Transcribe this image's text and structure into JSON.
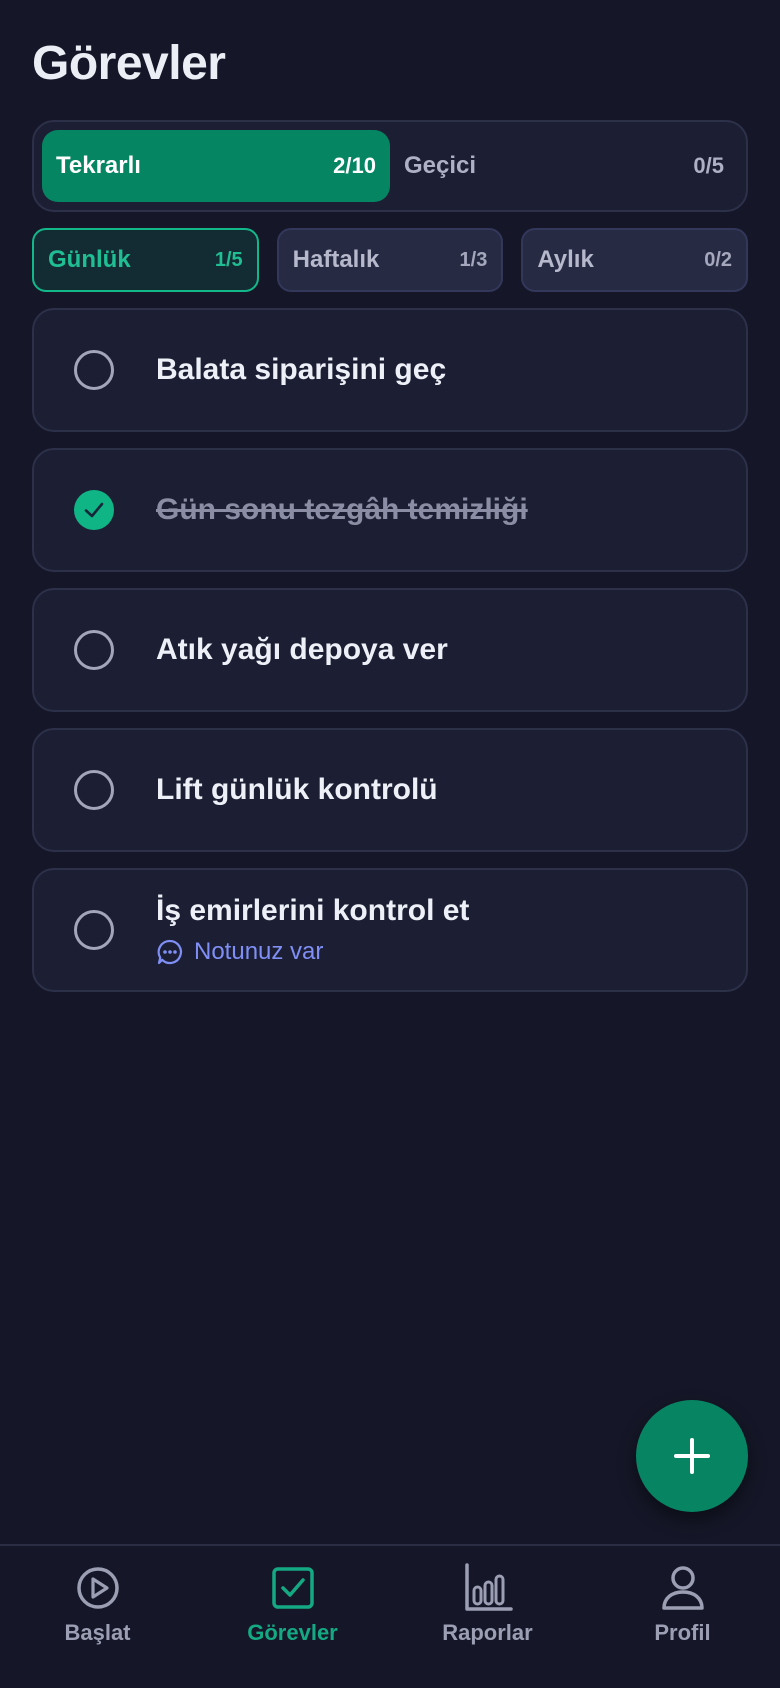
{
  "header": {
    "title": "Görevler"
  },
  "segments": [
    {
      "label": "Tekrarlı",
      "count": "2/10",
      "active": true
    },
    {
      "label": "Geçici",
      "count": "0/5",
      "active": false
    }
  ],
  "frequency_tabs": [
    {
      "label": "Günlük",
      "count": "1/5",
      "active": true
    },
    {
      "label": "Haftalık",
      "count": "1/3",
      "active": false
    },
    {
      "label": "Aylık",
      "count": "0/2",
      "active": false
    }
  ],
  "tasks": [
    {
      "text": "Balata siparişini geç",
      "done": false
    },
    {
      "text": "Gün sonu tezgâh temizliği",
      "done": true
    },
    {
      "text": "Atık yağı depoya ver",
      "done": false
    },
    {
      "text": "Lift günlük kontrolü",
      "done": false
    },
    {
      "text": "İş emirlerini kontrol et",
      "done": false,
      "note": "Notunuz var"
    }
  ],
  "fab": {
    "icon": "plus-icon"
  },
  "bottom_nav": [
    {
      "label": "Başlat",
      "icon": "play-circle-icon",
      "active": false
    },
    {
      "label": "Görevler",
      "icon": "checkbox-icon",
      "active": true
    },
    {
      "label": "Raporlar",
      "icon": "bar-chart-icon",
      "active": false
    },
    {
      "label": "Profil",
      "icon": "user-icon",
      "active": false
    }
  ],
  "colors": {
    "background": "#151728",
    "card": "#1c1f33",
    "accent": "#068563",
    "accent_light": "#1fbf93",
    "note": "#7f8ff5"
  }
}
